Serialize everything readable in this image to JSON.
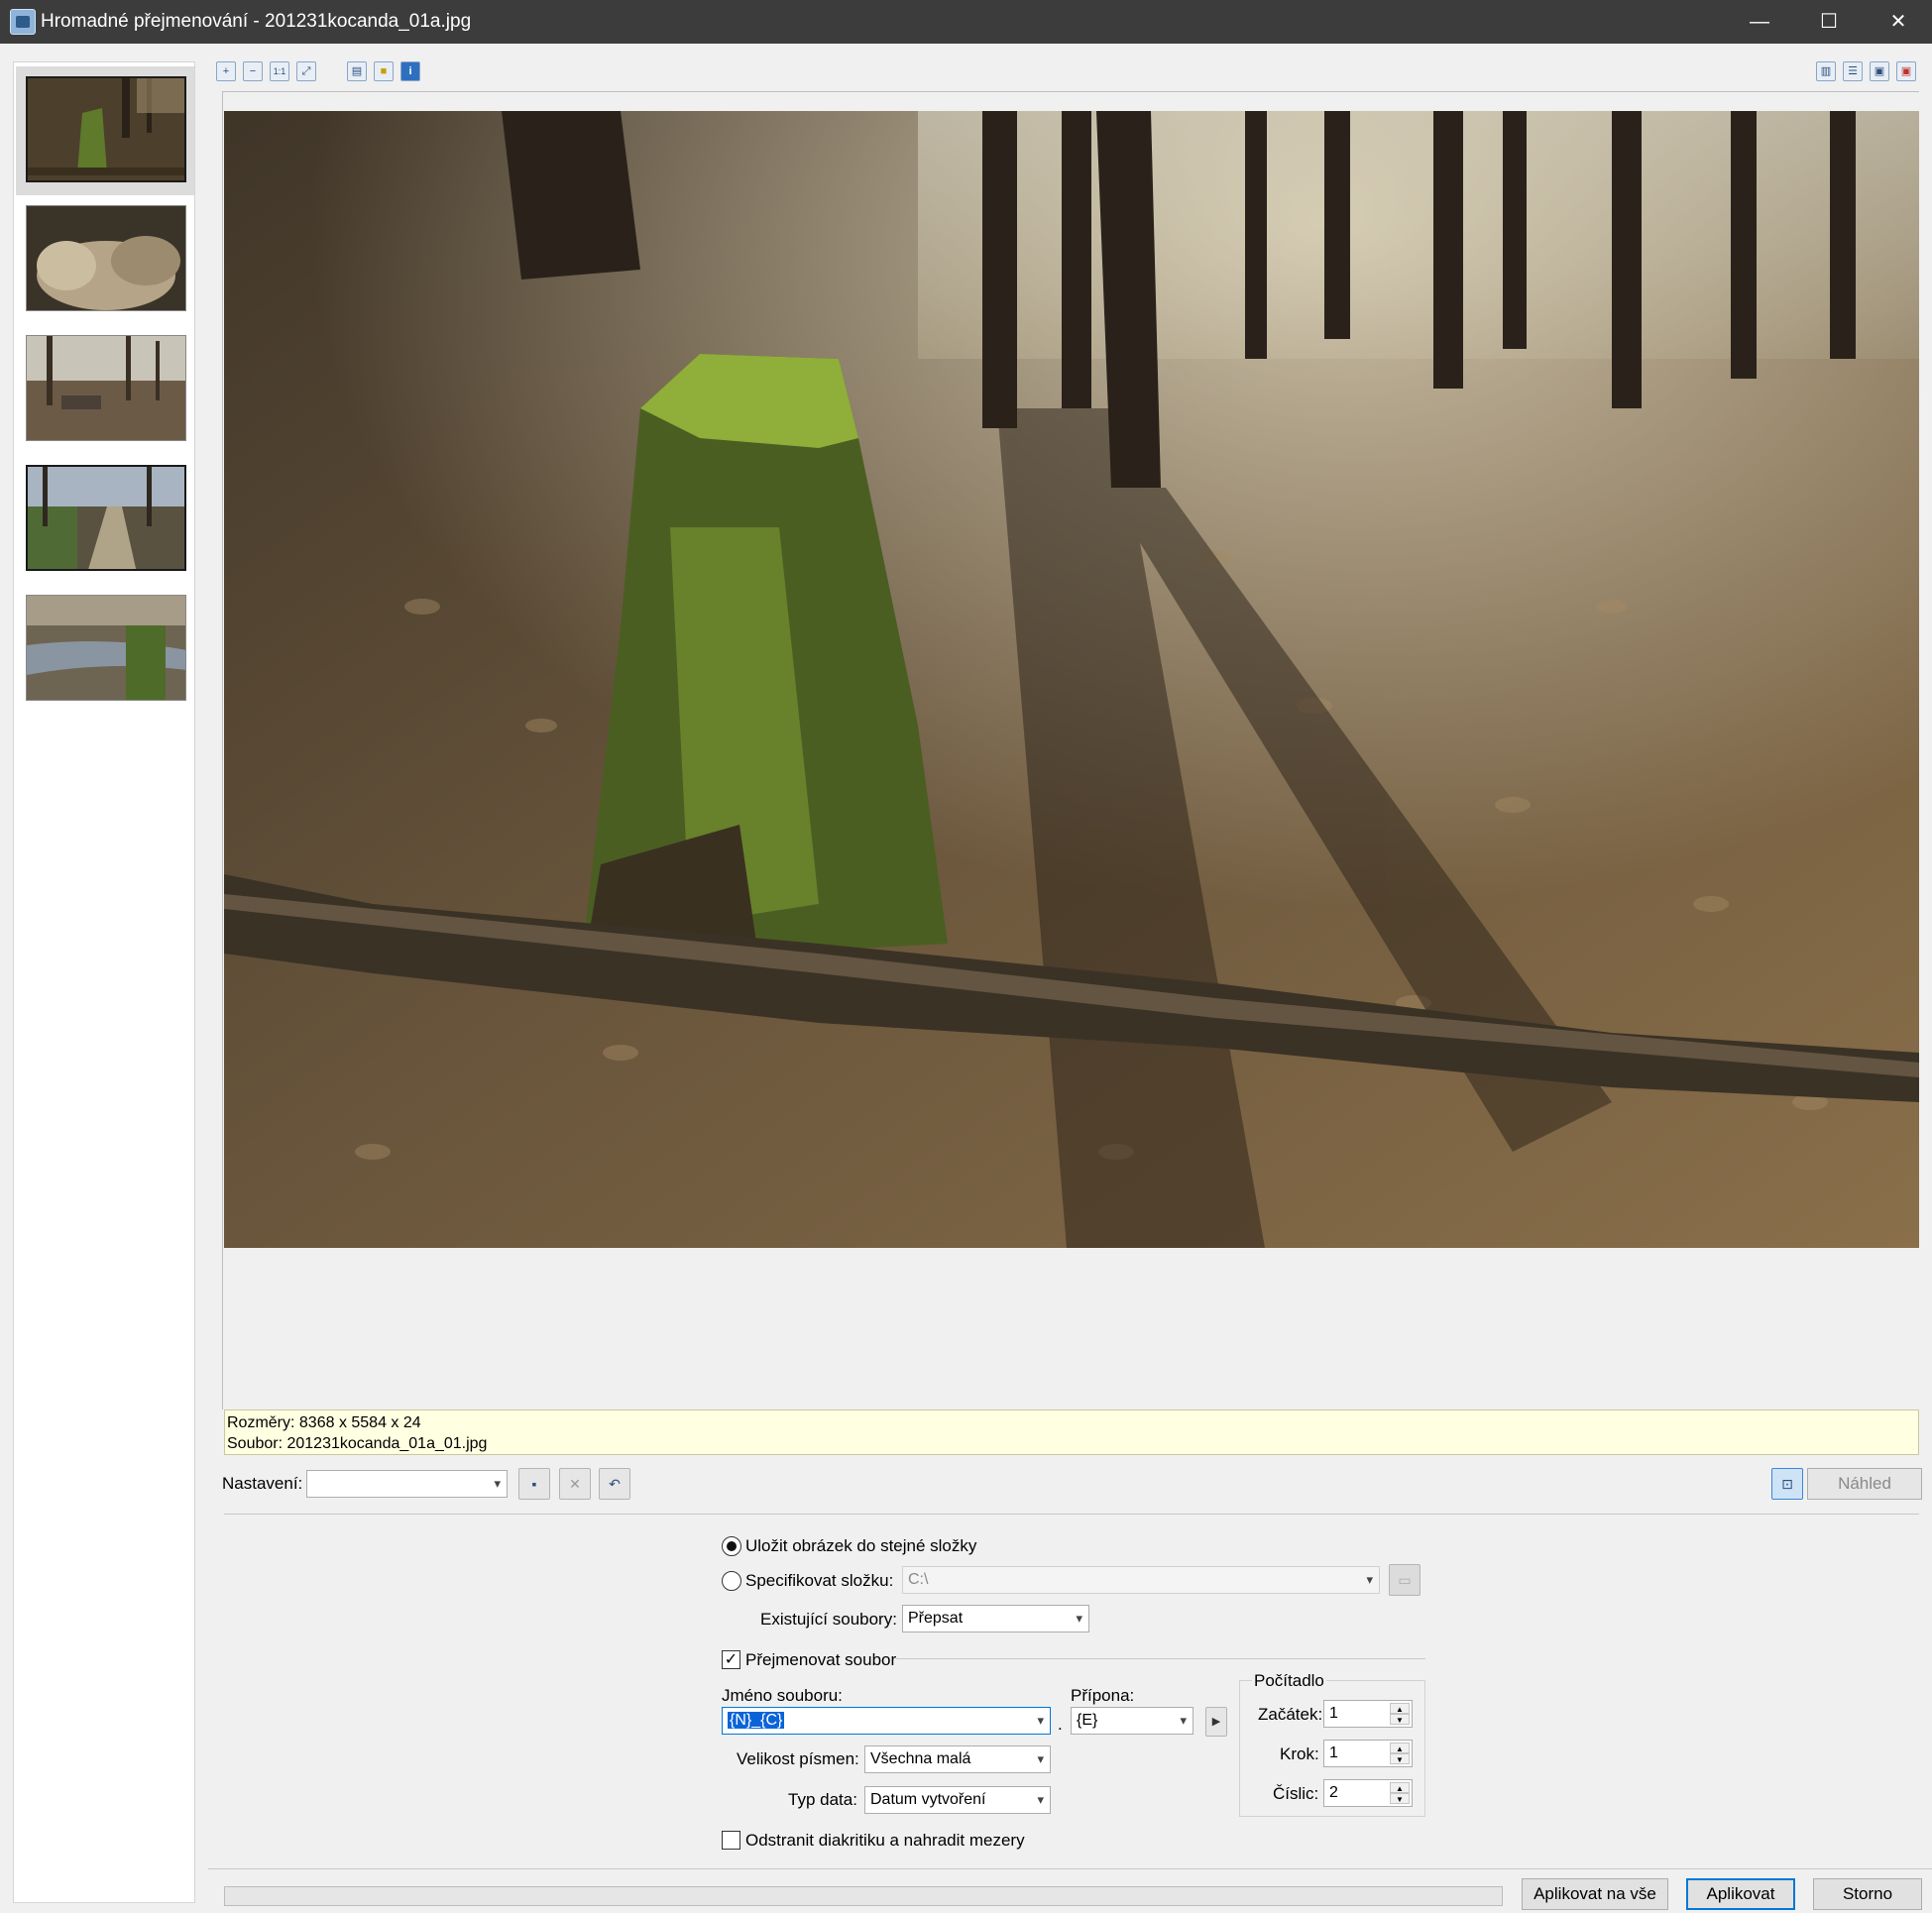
{
  "window": {
    "title": "Hromadné přejmenování - 201231kocanda_01a.jpg",
    "minimize": "—",
    "maximize": "☐",
    "close": "✕"
  },
  "thumbnails": [
    {
      "name": "thumb-1",
      "selected": true
    },
    {
      "name": "thumb-2",
      "selected": false
    },
    {
      "name": "thumb-3",
      "selected": false
    },
    {
      "name": "thumb-4",
      "selected": false
    },
    {
      "name": "thumb-5",
      "selected": false
    }
  ],
  "toolbar": {
    "zoom_in": "+",
    "zoom_out": "−",
    "actual_size": "1:1",
    "fit": "⤢",
    "view1": "▤",
    "view2": "■",
    "info": "i",
    "layout1": "▥",
    "layout2": "☰",
    "layout3": "▣",
    "layout4": "▣"
  },
  "info": {
    "dimensions": "Rozměry: 8368 x 5584 x 24",
    "file": "Soubor: 201231kocanda_01a_01.jpg"
  },
  "settings": {
    "label": "Nastavení:",
    "value": "",
    "preview_button": "Náhled"
  },
  "output": {
    "save_same_folder": "Uložit obrázek do stejné složky",
    "specify_folder": "Specifikovat složku:",
    "folder_value": "C:\\",
    "existing_files_label": "Existující soubory:",
    "existing_files_value": "Přepsat",
    "rename_file": "Přejmenovat soubor",
    "filename_label": "Jméno souboru:",
    "filename_value": "{N}_{C}",
    "extension_label": "Přípona:",
    "extension_value": "{E}",
    "dot": ".",
    "case_label": "Velikost písmen:",
    "case_value": "Všechna malá",
    "date_label": "Typ data:",
    "date_value": "Datum vytvoření",
    "remove_diacritics": "Odstranit diakritiku a nahradit mezery"
  },
  "counter": {
    "title": "Počítadlo",
    "start_label": "Začátek:",
    "start_value": "1",
    "step_label": "Krok:",
    "step_value": "1",
    "digits_label": "Číslic:",
    "digits_value": "2"
  },
  "buttons": {
    "apply_all": "Aplikovat na vše",
    "apply": "Aplikovat",
    "cancel": "Storno"
  },
  "colors": {
    "titlebar": "#3c3c3c",
    "info_bg": "#ffffe1",
    "accent": "#0078d7",
    "selection": "#0a64d8"
  }
}
